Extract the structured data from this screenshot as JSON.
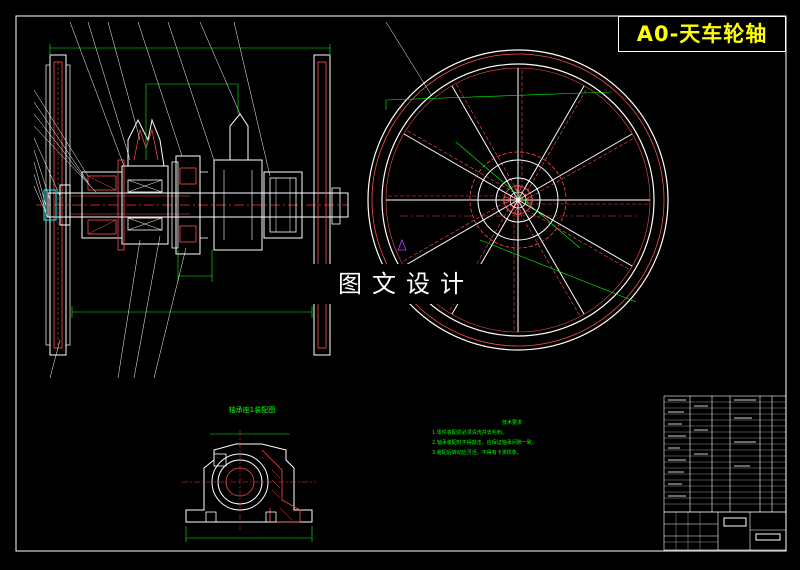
{
  "drawing": {
    "title": "A0-天车轮轴",
    "watermark": "图文设计",
    "bearing_view_title": "轴承座1装配图",
    "notes": {
      "title": "技术要求",
      "items": [
        "1.零件装配前必须清洗并去毛刺。",
        "2.轴承装配时不得敲击，应保证轴承间隙一致。",
        "3.装配后转动应灵活，不得有卡滞现象。"
      ]
    }
  },
  "colors": {
    "background": "#000000",
    "outline": "#ffffff",
    "section": "#ff4b4b",
    "dimension": "#00ff00",
    "title_text": "#ffff00",
    "centerline": "#ff3030"
  }
}
